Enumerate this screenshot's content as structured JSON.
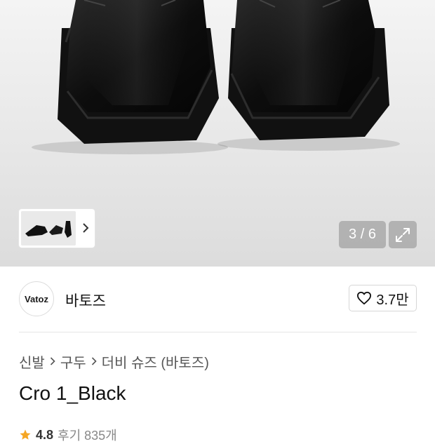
{
  "gallery": {
    "counter": "3 / 6",
    "thumbnail_alt": "shoe-thumbnails"
  },
  "brand": {
    "logo_text": "Vatoz",
    "name": "바토즈",
    "likes": "3.7만"
  },
  "breadcrumb": {
    "items": [
      "신발",
      "구두",
      "더비 슈즈 (바토즈)"
    ]
  },
  "product": {
    "title": "Cro 1_Black"
  },
  "rating": {
    "score": "4.8",
    "reviews": "후기 835개"
  },
  "colors": {
    "accent_star": "#f5a623"
  }
}
